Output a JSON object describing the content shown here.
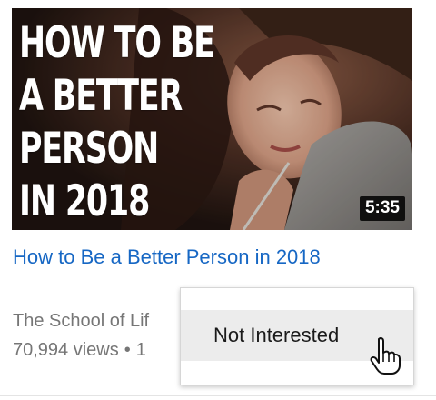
{
  "video": {
    "thumbnail_text_lines": [
      "HOW TO BE",
      "A BETTER",
      "PERSON",
      "IN 2018"
    ],
    "duration": "5:35",
    "title": "How to Be a Better Person in 2018",
    "channel": "The School of Lif",
    "views": "70,994 views",
    "separator": "•",
    "age_fragment": "1"
  },
  "menu": {
    "items": [
      {
        "label": "Not Interested",
        "hovered": true
      }
    ]
  },
  "colors": {
    "link_blue": "#1667c4",
    "meta_gray": "#767676",
    "menu_hover_bg": "#ececec"
  },
  "icons": {
    "cursor": "hand-pointer-icon"
  }
}
